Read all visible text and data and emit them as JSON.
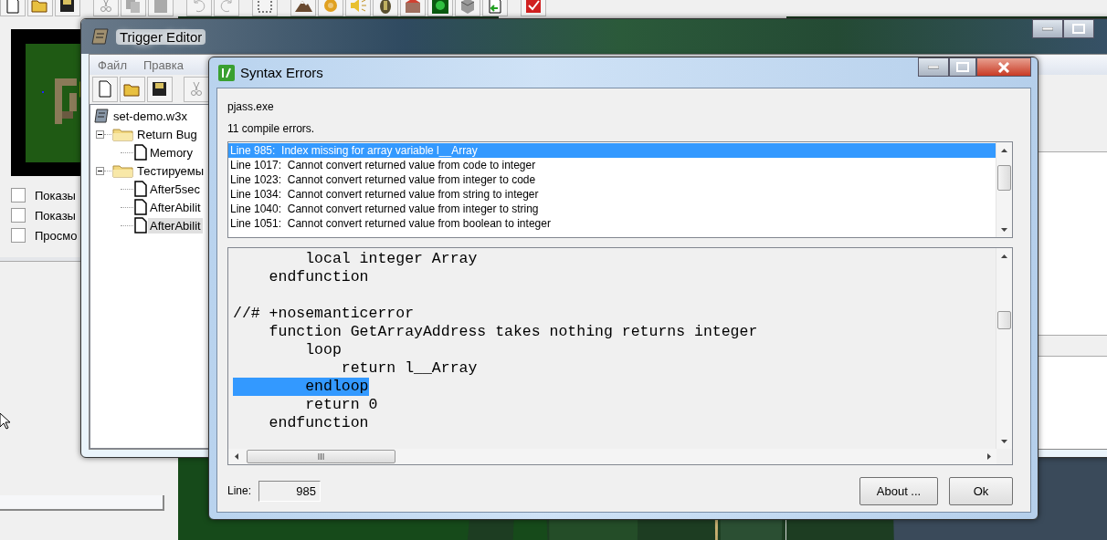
{
  "options": [
    {
      "label": "Показы",
      "checked": false
    },
    {
      "label": "Показы",
      "checked": false
    },
    {
      "label": "Просмо",
      "checked": false
    }
  ],
  "trigger_editor": {
    "title": "Trigger Editor",
    "menu": [
      "Файл",
      "Правка"
    ],
    "tree": [
      {
        "label": "set-demo.w3x",
        "kind": "map",
        "selected": false,
        "children": [
          {
            "label": "Return Bug",
            "kind": "folder",
            "expanded": true,
            "selected": false,
            "children": [
              {
                "label": "Memory",
                "kind": "trigger",
                "selected": false
              }
            ]
          },
          {
            "label": "Тестируемы",
            "kind": "folder",
            "expanded": true,
            "selected": false,
            "children": [
              {
                "label": "After5sec",
                "kind": "trigger",
                "selected": false
              },
              {
                "label": "AfterAbilit",
                "kind": "trigger",
                "selected": false
              },
              {
                "label": "AfterAbilit",
                "kind": "trigger",
                "selected": true
              }
            ]
          }
        ]
      }
    ]
  },
  "dialog": {
    "title": "Syntax Errors",
    "program": "pjass.exe",
    "summary": "11 compile errors.",
    "errors": [
      {
        "text": "Line 985:  Index missing for array variable l__Array",
        "selected": true
      },
      {
        "text": "Line 1017:  Cannot convert returned value from code to integer",
        "selected": false
      },
      {
        "text": "Line 1023:  Cannot convert returned value from integer to code",
        "selected": false
      },
      {
        "text": "Line 1034:  Cannot convert returned value from string to integer",
        "selected": false
      },
      {
        "text": "Line 1040:  Cannot convert returned value from integer to string",
        "selected": false
      },
      {
        "text": "Line 1051:  Cannot convert returned value from boolean to integer",
        "selected": false
      }
    ],
    "code": [
      {
        "text": "        local integer Array",
        "selected": false
      },
      {
        "text": "    endfunction",
        "selected": false
      },
      {
        "selected": false
      },
      {
        "text": "//# +nosemanticerror",
        "selected": false
      },
      {
        "text": "    function GetArrayAddress takes nothing returns integer",
        "selected": false
      },
      {
        "text": "        loop",
        "selected": false
      },
      {
        "text": "            return l__Array",
        "selected": false
      },
      {
        "text": "        endloop",
        "selected": true
      },
      {
        "text": "        return 0",
        "selected": false
      },
      {
        "text": "    endfunction",
        "selected": false
      }
    ],
    "line_label": "Line:",
    "line_value": "985",
    "buttons": [
      "About ...",
      "Ok"
    ]
  }
}
